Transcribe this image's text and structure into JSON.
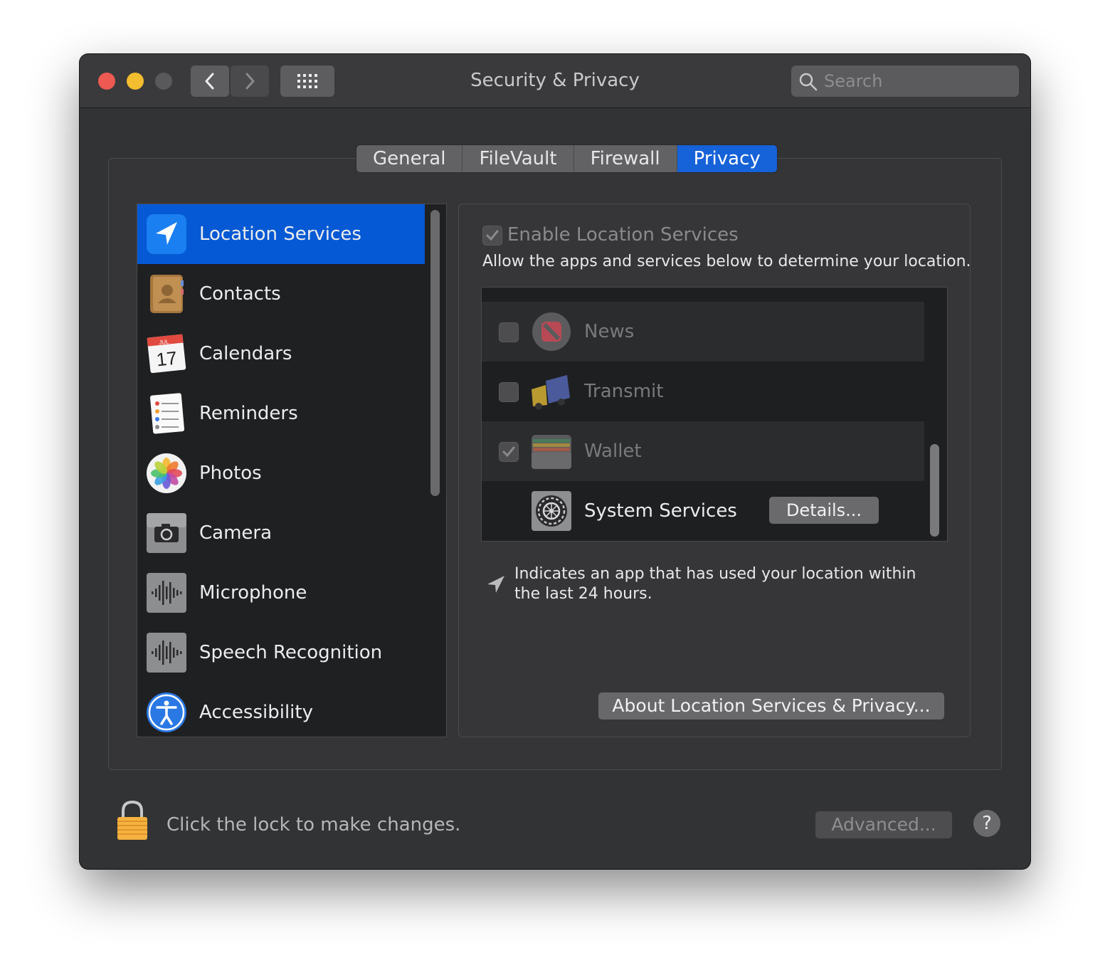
{
  "window": {
    "title": "Security & Privacy",
    "search_placeholder": "Search"
  },
  "tabs": [
    {
      "label": "General"
    },
    {
      "label": "FileVault"
    },
    {
      "label": "Firewall"
    },
    {
      "label": "Privacy",
      "active": true
    }
  ],
  "sidebar": {
    "items": [
      {
        "label": "Location Services",
        "icon": "location-arrow-icon",
        "selected": true
      },
      {
        "label": "Contacts",
        "icon": "contacts-book-icon"
      },
      {
        "label": "Calendars",
        "icon": "calendar-icon",
        "icon_month": "JUL",
        "icon_day": "17"
      },
      {
        "label": "Reminders",
        "icon": "reminders-list-icon"
      },
      {
        "label": "Photos",
        "icon": "photos-flower-icon"
      },
      {
        "label": "Camera",
        "icon": "camera-icon"
      },
      {
        "label": "Microphone",
        "icon": "waveform-icon"
      },
      {
        "label": "Speech Recognition",
        "icon": "waveform-icon"
      },
      {
        "label": "Accessibility",
        "icon": "accessibility-icon"
      }
    ]
  },
  "detail": {
    "enable_label": "Enable Location Services",
    "enable_checked": true,
    "allow_text": "Allow the apps and services below to determine your location.",
    "apps": [
      {
        "name": "News",
        "checked": false,
        "icon": "news-icon"
      },
      {
        "name": "Transmit",
        "checked": false,
        "icon": "truck-icon"
      },
      {
        "name": "Wallet",
        "checked": true,
        "icon": "wallet-icon"
      },
      {
        "name": "System Services",
        "icon": "gear-icon",
        "button": "Details..."
      }
    ],
    "note": "Indicates an app that has used your location within the last 24 hours.",
    "about_button": "About Location Services & Privacy..."
  },
  "footer": {
    "lock_text": "Click the lock to make changes.",
    "advanced_button": "Advanced...",
    "help_button": "?"
  },
  "colors": {
    "accent": "#0559d4",
    "window_bg": "#323335",
    "list_bg": "#1f2022"
  }
}
